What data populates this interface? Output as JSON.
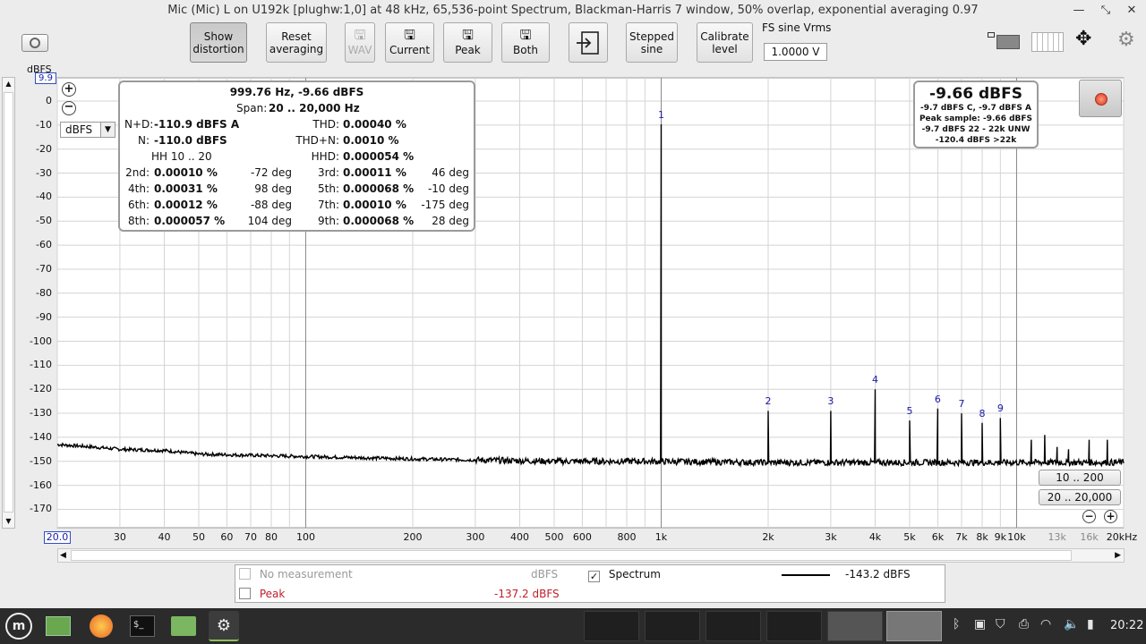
{
  "window": {
    "title": "Mic (Mic) L on U192k [plughw:1,0] at 48 kHz, 65,536-point Spectrum, Blackman-Harris 7 window, 50% overlap, exponential averaging 0.97",
    "minimize_glyph": "—",
    "restore_glyph": "⤡",
    "close_glyph": "✕"
  },
  "toolbar": {
    "show_distortion": [
      "Show",
      "distortion"
    ],
    "reset_averaging": [
      "Reset",
      "averaging"
    ],
    "wav": "WAV",
    "current": "Current",
    "peak": "Peak",
    "both": "Both",
    "stepped_sine": [
      "Stepped",
      "sine"
    ],
    "calibrate_level": [
      "Calibrate",
      "level"
    ],
    "fs_sine_label": "FS sine Vrms",
    "fs_sine_value": "1.0000 V"
  },
  "yaxis": {
    "unit": "dBFS",
    "top_value": "9.9",
    "ticks": [
      "0",
      "-10",
      "-20",
      "-30",
      "-40",
      "-50",
      "-60",
      "-70",
      "-80",
      "-90",
      "-100",
      "-110",
      "-120",
      "-130",
      "-140",
      "-150",
      "-160",
      "-170"
    ],
    "unit_select": "dBFS"
  },
  "xaxis": {
    "start_value": "20.0",
    "ticks": [
      {
        "label": "30",
        "hz": 30
      },
      {
        "label": "40",
        "hz": 40
      },
      {
        "label": "50",
        "hz": 50
      },
      {
        "label": "60",
        "hz": 60
      },
      {
        "label": "70",
        "hz": 70
      },
      {
        "label": "80",
        "hz": 80
      },
      {
        "label": "100",
        "hz": 100
      },
      {
        "label": "200",
        "hz": 200
      },
      {
        "label": "300",
        "hz": 300
      },
      {
        "label": "400",
        "hz": 400
      },
      {
        "label": "500",
        "hz": 500
      },
      {
        "label": "600",
        "hz": 600
      },
      {
        "label": "800",
        "hz": 800
      },
      {
        "label": "1k",
        "hz": 1000
      },
      {
        "label": "2k",
        "hz": 2000
      },
      {
        "label": "3k",
        "hz": 3000
      },
      {
        "label": "4k",
        "hz": 4000
      },
      {
        "label": "5k",
        "hz": 5000
      },
      {
        "label": "6k",
        "hz": 6000
      },
      {
        "label": "7k",
        "hz": 7000
      },
      {
        "label": "8k",
        "hz": 8000
      },
      {
        "label": "9k",
        "hz": 9000
      },
      {
        "label": "10k",
        "hz": 10000
      },
      {
        "label": "13k",
        "hz": 13000,
        "grey": true
      },
      {
        "label": "16k",
        "hz": 16000,
        "grey": true
      },
      {
        "label": "20kHz",
        "hz": 20000
      }
    ]
  },
  "distortion": {
    "header": "999.76 Hz, -9.66 dBFS",
    "span_label": "Span:",
    "span_value": "20 .. 20,000 Hz",
    "nd_label": "N+D:",
    "nd_value": "-110.9 dBFS A",
    "thd_label": "THD:",
    "thd_value": "0.00040 %",
    "n_label": "N:",
    "n_value": "-110.0 dBFS",
    "thdn_label": "THD+N:",
    "thdn_value": "0.0010 %",
    "hh_label": "HH 10 .. 20",
    "hhd_label": "HHD:",
    "hhd_value": "0.000054 %",
    "h2_label": "2nd:",
    "h2_value": "0.00010 %",
    "h2_deg": "-72 deg",
    "h3_label": "3rd:",
    "h3_value": "0.00011 %",
    "h3_deg": "46 deg",
    "h4_label": "4th:",
    "h4_value": "0.00031 %",
    "h4_deg": "98 deg",
    "h5_label": "5th:",
    "h5_value": "0.000068 %",
    "h5_deg": "-10 deg",
    "h6_label": "6th:",
    "h6_value": "0.00012 %",
    "h6_deg": "-88 deg",
    "h7_label": "7th:",
    "h7_value": "0.00010 %",
    "h7_deg": "-175 deg",
    "h8_label": "8th:",
    "h8_value": "0.000057 %",
    "h8_deg": "104 deg",
    "h9_label": "9th:",
    "h9_value": "0.000068 %",
    "h9_deg": "28 deg"
  },
  "level": {
    "main": "-9.66 dBFS",
    "line1": "-9.7 dBFS C, -9.7 dBFS A",
    "line2": "Peak sample: -9.66 dBFS",
    "line3": "-9.7 dBFS 22 - 22k UNW",
    "line4": "-120.4 dBFS >22k"
  },
  "range_buttons": {
    "r1": "10 .. 200",
    "r2": "20 .. 20,000"
  },
  "legend": {
    "no_measurement": "No measurement",
    "no_measurement_unit": "dBFS",
    "spectrum": "Spectrum",
    "spectrum_value": "-143.2 dBFS",
    "peak": "Peak",
    "peak_value": "-137.2 dBFS"
  },
  "clock": "20:22",
  "colors": {
    "trace": "#000000",
    "harmonic_label": "#1a1aa8",
    "peak_text": "#c0202a",
    "grid": "#c8c8c8"
  },
  "chart_data": {
    "type": "line",
    "xscale": "log",
    "xlim": [
      20,
      20000
    ],
    "ylim": [
      -180,
      9.9
    ],
    "ylabel": "dBFS",
    "fundamental": {
      "hz": 999.76,
      "db": -9.66
    },
    "harmonics": [
      {
        "n": "1",
        "hz": 1000,
        "db": -9.7
      },
      {
        "n": "2",
        "hz": 2000,
        "db": -129
      },
      {
        "n": "3",
        "hz": 3000,
        "db": -129
      },
      {
        "n": "4",
        "hz": 4000,
        "db": -120
      },
      {
        "n": "5",
        "hz": 5000,
        "db": -133
      },
      {
        "n": "6",
        "hz": 6000,
        "db": -128
      },
      {
        "n": "7",
        "hz": 7000,
        "db": -130
      },
      {
        "n": "8",
        "hz": 8000,
        "db": -134
      },
      {
        "n": "9",
        "hz": 9000,
        "db": -132
      }
    ],
    "extra_spurs": [
      {
        "hz": 11000,
        "db": -141
      },
      {
        "hz": 12000,
        "db": -139
      },
      {
        "hz": 13000,
        "db": -144
      },
      {
        "hz": 14000,
        "db": -145
      },
      {
        "hz": 16000,
        "db": -141
      },
      {
        "hz": 18000,
        "db": -141
      }
    ],
    "noise_floor": [
      {
        "hz": 20,
        "db": -143
      },
      {
        "hz": 25,
        "db": -144
      },
      {
        "hz": 30,
        "db": -145
      },
      {
        "hz": 40,
        "db": -145.5
      },
      {
        "hz": 50,
        "db": -147
      },
      {
        "hz": 70,
        "db": -147.5
      },
      {
        "hz": 100,
        "db": -148
      },
      {
        "hz": 200,
        "db": -149
      },
      {
        "hz": 500,
        "db": -150
      },
      {
        "hz": 900,
        "db": -150
      },
      {
        "hz": 2000,
        "db": -150.5
      },
      {
        "hz": 5000,
        "db": -150.5
      },
      {
        "hz": 10000,
        "db": -150.5
      },
      {
        "hz": 20000,
        "db": -150.5
      }
    ]
  }
}
